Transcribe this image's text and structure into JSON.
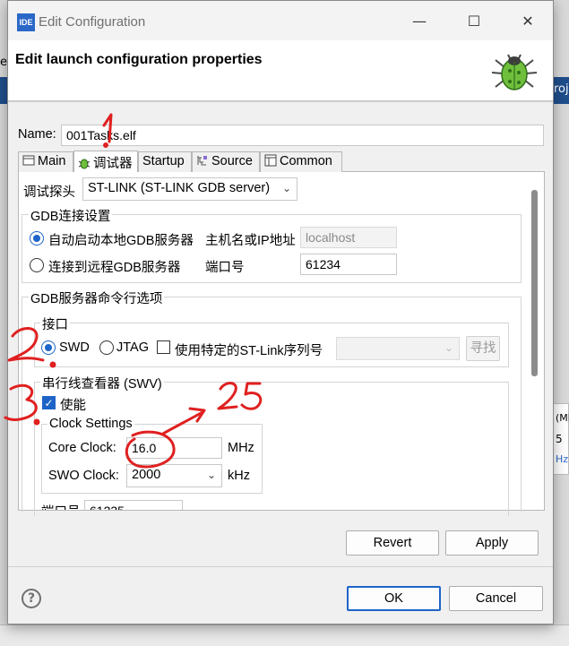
{
  "window": {
    "app_icon_text": "IDE",
    "title": "Edit Configuration",
    "minimize": "—",
    "maximize": "☐",
    "close": "✕"
  },
  "banner": {
    "title": "Edit launch configuration properties",
    "icon": "debug-bug-icon"
  },
  "name": {
    "label": "Name:",
    "value": "001Tasks.elf"
  },
  "tabs": [
    {
      "label": "Main",
      "icon": "main-tab-icon"
    },
    {
      "label": "调试器",
      "icon": "debugger-tab-icon",
      "active": true
    },
    {
      "label": "Startup"
    },
    {
      "label": "Source",
      "icon": "source-tab-icon"
    },
    {
      "label": "Common",
      "icon": "common-tab-icon"
    }
  ],
  "debugger": {
    "probe_label": "调试探头",
    "probe_value": "ST-LINK (ST-LINK GDB server)",
    "gdb_connection": {
      "title": "GDB连接设置",
      "auto_start_label": "自动启动本地GDB服务器",
      "remote_label": "连接到远程GDB服务器",
      "host_label": "主机名或IP地址",
      "host_value": "localhost",
      "port_label": "端口号",
      "port_value": "61234"
    },
    "gdb_server_options": {
      "title": "GDB服务器命令行选项",
      "interface": {
        "title": "接口",
        "swd_label": "SWD",
        "jtag_label": "JTAG",
        "serial_label": "使用特定的ST-Link序列号",
        "find_button": "寻找"
      },
      "swv": {
        "title": "串行线查看器 (SWV)",
        "enable_label": "使能",
        "clock_settings": {
          "title": "Clock Settings",
          "core_label": "Core Clock:",
          "core_value": "16.0",
          "core_unit": "MHz",
          "swo_label": "SWO Clock:",
          "swo_value": "2000",
          "swo_unit": "kHz"
        },
        "port_label": "端口号",
        "port_value": "61235"
      }
    }
  },
  "buttons": {
    "revert": "Revert",
    "apply": "Apply",
    "ok": "OK",
    "cancel": "Cancel",
    "help": "?"
  },
  "annotations": {
    "note_1": "1",
    "note_2": "2",
    "note_3": "3",
    "note_25": "25",
    "color": "#e02020"
  },
  "background": {
    "right_fragment_1": "roj",
    "right_fragment_2": "(MH",
    "right_fragment_3": "5",
    "right_fragment_4": "Hz",
    "left_fragment": "e"
  }
}
